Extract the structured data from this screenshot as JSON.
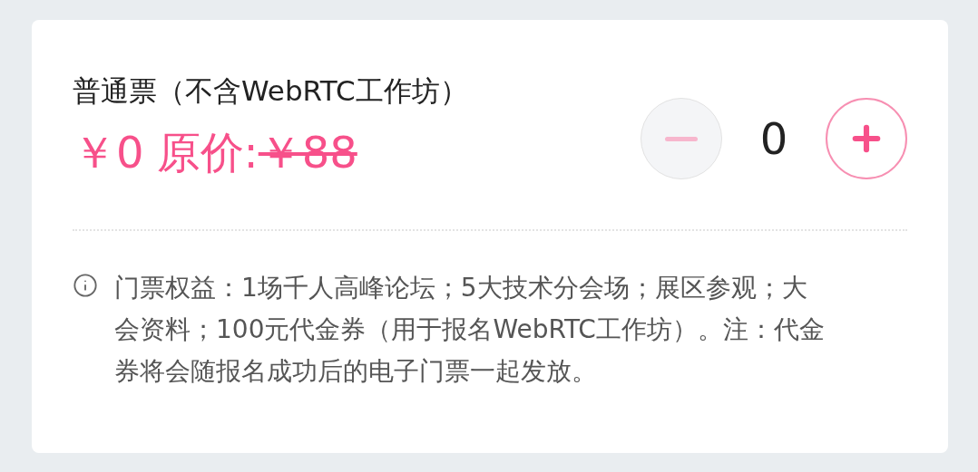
{
  "ticket": {
    "title": "普通票（不含WebRTC工作坊）",
    "price": "￥0",
    "original_label": "原价:",
    "original_price": "￥88"
  },
  "stepper": {
    "minus_disabled": true,
    "count": "0",
    "plus_disabled": false
  },
  "info": {
    "text": "门票权益：1场千人高峰论坛；5大技术分会场；展区参观；大会资料；100元代金券（用于报名WebRTC工作坊）。注：代金券将会随报名成功后的电子门票一起发放。"
  }
}
